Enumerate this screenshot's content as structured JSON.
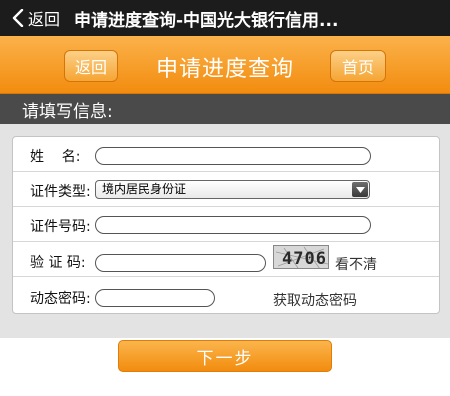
{
  "titlebar": {
    "back_label": "返回",
    "title": "申请进度查询-中国光大银行信用..."
  },
  "header": {
    "back_label": "返回",
    "title": "申请进度查询",
    "home_label": "首页"
  },
  "section": {
    "title": "请填写信息:"
  },
  "form": {
    "name_label": "姓    名:",
    "name_value": "",
    "id_type_label": "证件类型:",
    "id_type_selected": "境内居民身份证",
    "id_number_label": "证件号码:",
    "id_number_value": "",
    "captcha_label": "验 证 码:",
    "captcha_value": "",
    "captcha_code": "4706",
    "captcha_refresh": "看不清",
    "dynamic_pw_label": "动态密码:",
    "dynamic_pw_value": "",
    "get_dynamic_pw": "获取动态密码"
  },
  "actions": {
    "next_label": "下一步"
  },
  "colors": {
    "accent": "#f28c0f",
    "titlebar": "#1c1c1c",
    "section": "#4a4a4a",
    "background": "#e3e3e3"
  },
  "icons": {
    "titlebar_back": "chevron-left-icon",
    "select_arrow": "triangle-down-icon"
  }
}
